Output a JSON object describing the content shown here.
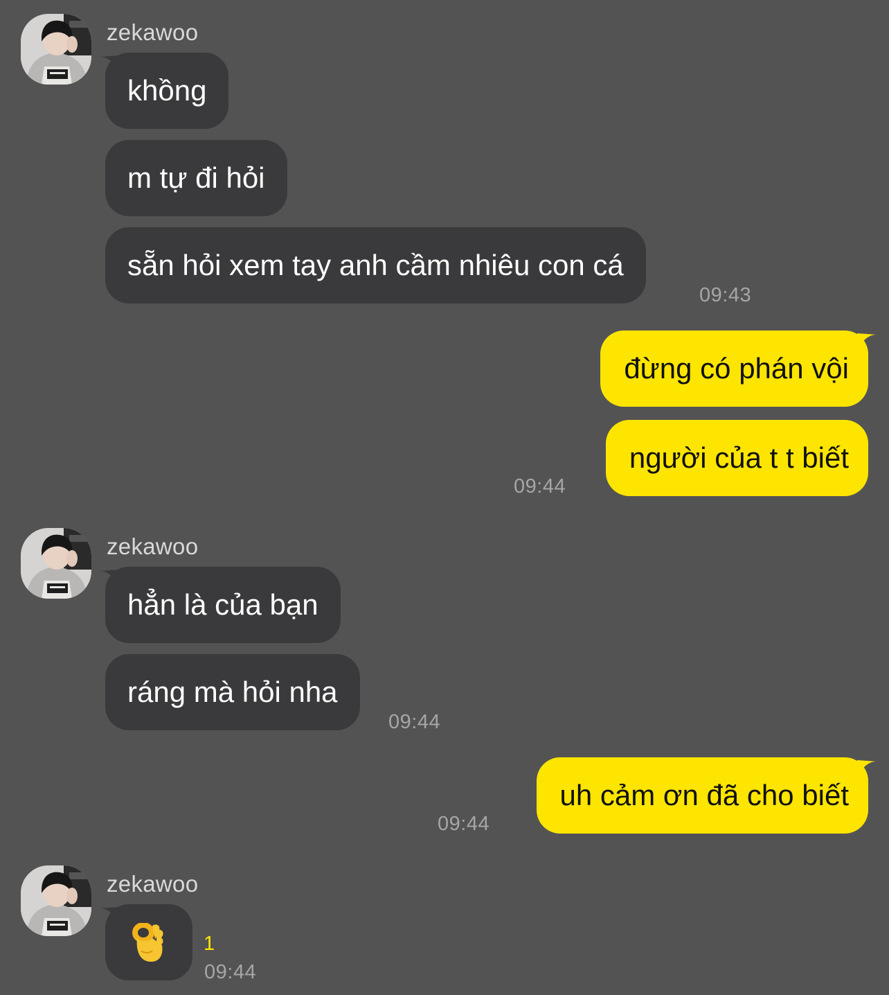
{
  "colors": {
    "background": "#545354",
    "incoming_bubble": "#3a3a3c",
    "outgoing_bubble": "#fee500",
    "unread_count": "#fee500"
  },
  "groups": [
    {
      "sender": "zekawoo",
      "messages": [
        "khồng",
        "m tự đi hỏi",
        "sẵn hỏi xem tay anh cầm nhiêu con cá"
      ],
      "time": "09:43"
    },
    {
      "direction": "out",
      "messages": [
        "đừng có phán vội",
        "người của t t biết"
      ],
      "time": "09:44"
    },
    {
      "sender": "zekawoo",
      "messages": [
        "hẳn là của bạn",
        "ráng mà hỏi nha"
      ],
      "time": "09:44"
    },
    {
      "direction": "out",
      "messages": [
        "uh cảm ơn đã cho biết"
      ],
      "time": "09:44"
    },
    {
      "sender": "zekawoo",
      "messages": [
        "ok-hand-emoji"
      ],
      "unread": "1",
      "time": "09:44"
    }
  ]
}
